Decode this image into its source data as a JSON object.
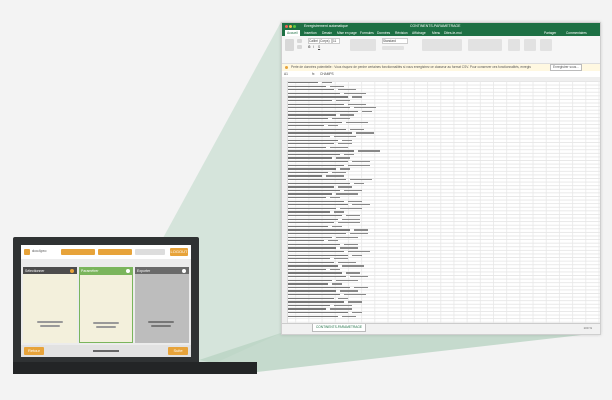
{
  "laptop": {
    "brand": "doc4pro",
    "logout_label": "LOGOUT",
    "col1_header": "Sélectionner",
    "col2_header": "Paramétrer",
    "col3_header": "Exporter",
    "back_label": "Retour",
    "next_label": "Suite"
  },
  "excel": {
    "window_title": "Enregistrement automatique",
    "file_name": "CONTINENTS-PARAMETRAGE",
    "tabs": [
      "Accueil",
      "Insertion",
      "Dessin",
      "Mise en page",
      "Formules",
      "Données",
      "Révision",
      "Affichage",
      "Menu",
      "Dites-le-moi"
    ],
    "share_label": "Partager",
    "comments_label": "Commentaires",
    "font_name": "Calibri (Corps)",
    "font_size": "11",
    "number_format": "Standard",
    "warning_text": "Perte de données potentielle : Vous risquez de perdre certaines fonctionnalités si vous enregistrez ce classeur au format CSV. Pour conserver ces fonctionnalités, enregistrez-le...",
    "save_as_button": "Enregistrer sous...",
    "name_box": "A1",
    "formula_value": "CHAMPS",
    "sheet_tab": "CONTINENTS-PARAMETRAGE",
    "zoom_label": "100 %"
  }
}
